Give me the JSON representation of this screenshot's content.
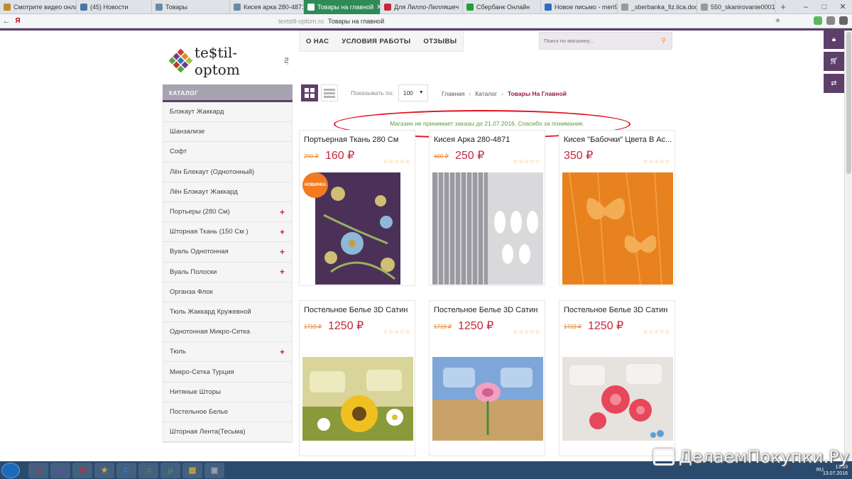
{
  "browser": {
    "tabs": [
      {
        "label": "Смотрите видео онлай",
        "icon": "video-icon",
        "color": "#c08a2a"
      },
      {
        "label": "(45) Новости",
        "icon": "vk-icon",
        "color": "#4a76a8"
      },
      {
        "label": "Товары",
        "icon": "page-icon",
        "color": "#6a8aa8"
      },
      {
        "label": "Кисея арка 280-4871 ·",
        "icon": "page-icon",
        "color": "#6a8aa8"
      },
      {
        "label": "Товары на главной",
        "icon": "page-icon",
        "color": "#ffffff",
        "active": true
      },
      {
        "label": "Для Лилло-Лилляшеч",
        "icon": "mail-icon",
        "color": "#c4283c"
      },
      {
        "label": "Сбербанк Онлайн",
        "icon": "sberbank-icon",
        "color": "#21a038"
      },
      {
        "label": "Новое письмо - meri9",
        "icon": "mail-icon",
        "color": "#2a70c0"
      },
      {
        "label": "_sberbanka_fiz.lica.docx",
        "icon": "doc-icon",
        "color": "#999999"
      },
      {
        "label": "550_skanirovanie0001.jp",
        "icon": "image-icon",
        "color": "#999999"
      }
    ],
    "new_tab": "+",
    "address": {
      "back": "←",
      "yandex": "Я",
      "host": "textstil-optom.ru",
      "page_title": "Товары на главной"
    }
  },
  "site": {
    "logo_text": "te$til-optom",
    "logo_tld": ".ru",
    "nav": [
      "О НАС",
      "УСЛОВИЯ РАБОТЫ",
      "ОТЗЫВЫ"
    ],
    "search_placeholder": "Поиск по магазину..."
  },
  "catalog": {
    "title": "КАТАЛОГ",
    "items": [
      {
        "label": "Блэкаут Жаккард",
        "expandable": false
      },
      {
        "label": "Шанзализе",
        "expandable": false
      },
      {
        "label": "Софт",
        "expandable": false
      },
      {
        "label": "Лён Блекаут (Однотонный)",
        "expandable": false
      },
      {
        "label": "Лён Блэкаут Жаккард",
        "expandable": false
      },
      {
        "label": "Портьеры (280 См)",
        "expandable": true
      },
      {
        "label": "Шторная Ткань (150 См )",
        "expandable": true
      },
      {
        "label": "Вуаль Однотонная",
        "expandable": true
      },
      {
        "label": "Вуаль Полоски",
        "expandable": true
      },
      {
        "label": "Органза Флок",
        "expandable": false
      },
      {
        "label": "Тюль Жаккард Кружевной",
        "expandable": false
      },
      {
        "label": "Однотонная Микро-Сетка",
        "expandable": false
      },
      {
        "label": "Тюль",
        "expandable": true
      },
      {
        "label": "Микро-Сетка Турция",
        "expandable": false
      },
      {
        "label": "Нитяные Шторы",
        "expandable": false
      },
      {
        "label": "Постельное Белье",
        "expandable": false
      },
      {
        "label": "Шторная Лента(Тесьма)",
        "expandable": false
      }
    ]
  },
  "toolbar": {
    "show_label": "Показывать по:",
    "per_page": "100",
    "breadcrumbs": [
      "Главная",
      "Каталог",
      "Товары На Главной"
    ]
  },
  "notice": "Магазин не принимает заказы до 21.07.2016. Спасибо за понимание.",
  "products": [
    {
      "title": "Портьерная Ткань 280 См",
      "old_price": "290 ₽",
      "price": "160 ₽",
      "badge": "НОВИНКА",
      "image": "purple-floral"
    },
    {
      "title": "Кисея Арка 280-4871",
      "old_price": "400 ₽",
      "price": "250 ₽",
      "badge": "",
      "image": "white-string-curtain"
    },
    {
      "title": "Кисея \"Бабочки\" Цвета В Ас...",
      "old_price": "",
      "price": "350 ₽",
      "badge": "",
      "image": "orange-butterfly"
    },
    {
      "title": "Постельное Белье 3D Сатин",
      "old_price": "1719 ₽",
      "price": "1250 ₽",
      "badge": "",
      "image": "sunflower-bedding"
    },
    {
      "title": "Постельное Белье 3D Сатин",
      "old_price": "1719 ₽",
      "price": "1250 ₽",
      "badge": "",
      "image": "rose-bedding"
    },
    {
      "title": "Постельное Белье 3D Сатин",
      "old_price": "1719 ₽",
      "price": "1250 ₽",
      "badge": "",
      "image": "red-flower-bedding"
    }
  ],
  "taskbar": {
    "apps": [
      "Y",
      "VS",
      "Я",
      "★",
      "C",
      "♫",
      "μ",
      "▤",
      "▣"
    ],
    "lang": "RU",
    "time": "13:33",
    "date": "13.07.2016"
  },
  "watermark": "ДелаемПокупки.Ру"
}
